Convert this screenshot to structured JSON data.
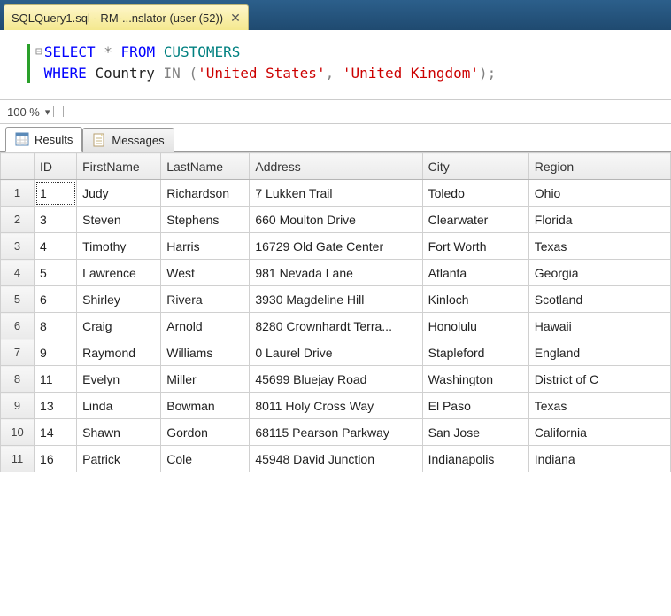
{
  "tab": {
    "title": "SQLQuery1.sql - RM-...nslator (user (52))"
  },
  "zoom": "100 %",
  "sql": {
    "line1": {
      "kw1": "SELECT",
      "op": "*",
      "kw2": "FROM",
      "obj": "CUSTOMERS"
    },
    "line2": {
      "kw1": "WHERE",
      "col": "Country",
      "kw2": "IN",
      "p1": "(",
      "s1": "'United States'",
      "c": ",",
      "s2": "'United Kingdom'",
      "p2": ");"
    }
  },
  "panelTabs": {
    "results": "Results",
    "messages": "Messages"
  },
  "columns": {
    "rowNum": "",
    "id": "ID",
    "firstName": "FirstName",
    "lastName": "LastName",
    "address": "Address",
    "city": "City",
    "region": "Region"
  },
  "rows": [
    {
      "n": "1",
      "id": "1",
      "fn": "Judy",
      "ln": "Richardson",
      "addr": "7 Lukken Trail",
      "city": "Toledo",
      "reg": "Ohio"
    },
    {
      "n": "2",
      "id": "3",
      "fn": "Steven",
      "ln": "Stephens",
      "addr": "660 Moulton Drive",
      "city": "Clearwater",
      "reg": "Florida"
    },
    {
      "n": "3",
      "id": "4",
      "fn": "Timothy",
      "ln": "Harris",
      "addr": "16729 Old Gate Center",
      "city": "Fort Worth",
      "reg": "Texas"
    },
    {
      "n": "4",
      "id": "5",
      "fn": "Lawrence",
      "ln": "West",
      "addr": "981 Nevada Lane",
      "city": "Atlanta",
      "reg": "Georgia"
    },
    {
      "n": "5",
      "id": "6",
      "fn": "Shirley",
      "ln": "Rivera",
      "addr": "3930 Magdeline Hill",
      "city": "Kinloch",
      "reg": "Scotland"
    },
    {
      "n": "6",
      "id": "8",
      "fn": "Craig",
      "ln": "Arnold",
      "addr": "8280 Crownhardt Terra...",
      "city": "Honolulu",
      "reg": "Hawaii"
    },
    {
      "n": "7",
      "id": "9",
      "fn": "Raymond",
      "ln": "Williams",
      "addr": "0 Laurel Drive",
      "city": "Stapleford",
      "reg": "England"
    },
    {
      "n": "8",
      "id": "11",
      "fn": "Evelyn",
      "ln": "Miller",
      "addr": "45699 Bluejay Road",
      "city": "Washington",
      "reg": "District of C"
    },
    {
      "n": "9",
      "id": "13",
      "fn": "Linda",
      "ln": "Bowman",
      "addr": "8011 Holy Cross Way",
      "city": "El Paso",
      "reg": "Texas"
    },
    {
      "n": "10",
      "id": "14",
      "fn": "Shawn",
      "ln": "Gordon",
      "addr": "68115 Pearson Parkway",
      "city": "San Jose",
      "reg": "California"
    },
    {
      "n": "11",
      "id": "16",
      "fn": "Patrick",
      "ln": "Cole",
      "addr": "45948 David Junction",
      "city": "Indianapolis",
      "reg": "Indiana"
    }
  ]
}
